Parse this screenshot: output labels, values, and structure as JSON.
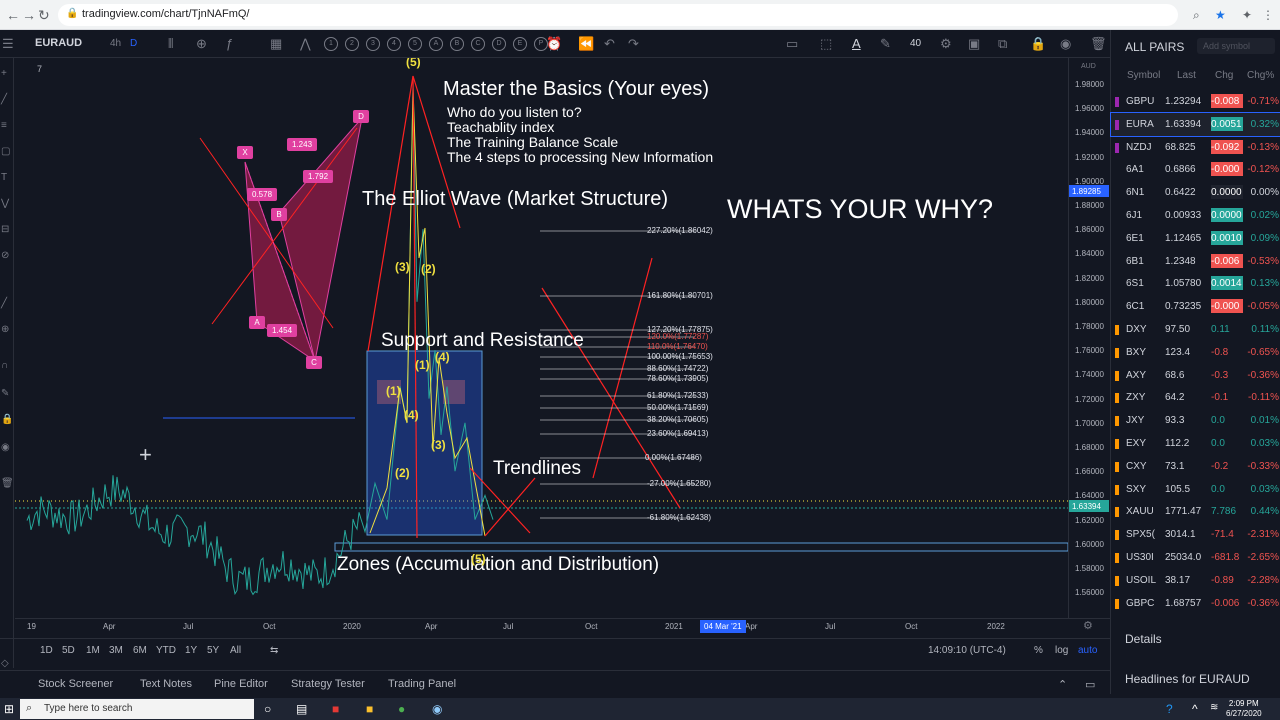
{
  "browser": {
    "url": "tradingview.com/chart/TjnNAFmQ/"
  },
  "toolbar": {
    "symbol": "EURAUD",
    "interval": "4h",
    "interval_sel": "D",
    "zoom": "40",
    "wave_marks": [
      "1",
      "2",
      "3",
      "4",
      "5",
      "A",
      "B",
      "C",
      "D",
      "E",
      "P"
    ]
  },
  "chart": {
    "counter": "7",
    "price_ticks": [
      "1.98000",
      "1.96000",
      "1.94000",
      "1.92000",
      "1.90000",
      "1.88000",
      "1.86000",
      "1.84000",
      "1.82000",
      "1.80000",
      "1.78000",
      "1.76000",
      "1.74000",
      "1.72000",
      "1.70000",
      "1.68000",
      "1.66000",
      "1.64000",
      "1.62000",
      "1.60000",
      "1.58000",
      "1.56000"
    ],
    "current_price": "1.89285",
    "last_price_tag": "1.63394",
    "axis_top": "AUD",
    "time_ticks": [
      "19",
      "Apr",
      "Jul",
      "Oct",
      "2020",
      "Apr",
      "Jul",
      "Oct",
      "2021",
      "Apr",
      "Jul",
      "Oct",
      "2022"
    ],
    "cursor_date": "04 Mar '21",
    "annotations": {
      "title": "Master the Basics (Your eyes)",
      "line1": "Who do you listen to?",
      "line2": "Teachablity index",
      "line3": "The Training Balance Scale",
      "line4": "The 4 steps to processing New Information",
      "elliot": "The Elliot Wave (Market Structure)",
      "why": "WHATS YOUR WHY?",
      "sr": "Support and Resistance",
      "trend": "Trendlines",
      "zones": "Zones (Accumulation and Distribution)"
    },
    "fib_levels": [
      "227.20%(1.86042)",
      "161.80%(1.80701)",
      "127.20%(1.77875)",
      "120.0%(1.77287)",
      "110.0%(1.76470)",
      "100.00%(1.75653)",
      "88.60%(1.74722)",
      "78.60%(1.73905)",
      "61.80%(1.72533)",
      "50.00%(1.71569)",
      "38.20%(1.70605)",
      "23.60%(1.69413)",
      "0.00%(1.67486)",
      "-27.00%(1.65280)",
      "-61.80%(1.62438)"
    ],
    "harmonic": {
      "points": [
        "X",
        "A",
        "B",
        "C",
        "D"
      ],
      "ratios": [
        "1.243",
        "0.578",
        "1.792",
        "1.454"
      ]
    },
    "waves": [
      "(5)",
      "(3)",
      "(2)",
      "(1)",
      "(4)",
      "(1)",
      "(4)",
      "(3)",
      "(2)",
      "(5)"
    ]
  },
  "range_bar": {
    "ranges": [
      "1D",
      "5D",
      "1M",
      "3M",
      "6M",
      "YTD",
      "1Y",
      "5Y",
      "All"
    ],
    "time": "14:09:10 (UTC-4)",
    "pct": "%",
    "log": "log",
    "auto": "auto"
  },
  "panel_tabs": [
    "Stock Screener",
    "Text Notes",
    "Pine Editor",
    "Strategy Tester",
    "Trading Panel"
  ],
  "watchlist": {
    "title": "ALL PAIRS",
    "add_placeholder": "Add symbol",
    "headers": [
      "Symbol",
      "Last",
      "Chg",
      "Chg%"
    ],
    "rows": [
      {
        "sym": "GBPU",
        "last": "1.23294",
        "chg": "-0.008",
        "chgp": "-0.71%",
        "dir": "neg",
        "flag": "#9c27b0"
      },
      {
        "sym": "EURA",
        "last": "1.63394",
        "chg": "0.0051",
        "chgp": "0.32%",
        "dir": "pos",
        "flag": "#9c27b0"
      },
      {
        "sym": "NZDJ",
        "last": "68.825",
        "chg": "-0.092",
        "chgp": "-0.13%",
        "dir": "neg",
        "flag": "#9c27b0"
      },
      {
        "sym": "6A1",
        "last": "0.6866",
        "chg": "-0.000",
        "chgp": "-0.12%",
        "dir": "neg",
        "flag": "#131722"
      },
      {
        "sym": "6N1",
        "last": "0.6422",
        "chg": "0.0000",
        "chgp": "0.00%",
        "dir": "neu",
        "flag": "#131722"
      },
      {
        "sym": "6J1",
        "last": "0.00933",
        "chg": "0.0000",
        "chgp": "0.02%",
        "dir": "pos",
        "flag": "#131722"
      },
      {
        "sym": "6E1",
        "last": "1.12465",
        "chg": "0.0010",
        "chgp": "0.09%",
        "dir": "pos",
        "flag": "#131722"
      },
      {
        "sym": "6B1",
        "last": "1.2348",
        "chg": "-0.006",
        "chgp": "-0.53%",
        "dir": "neg",
        "flag": "#131722"
      },
      {
        "sym": "6S1",
        "last": "1.05780",
        "chg": "0.0014",
        "chgp": "0.13%",
        "dir": "pos",
        "flag": "#131722"
      },
      {
        "sym": "6C1",
        "last": "0.73235",
        "chg": "-0.000",
        "chgp": "-0.05%",
        "dir": "neg",
        "flag": "#131722"
      },
      {
        "sym": "DXY",
        "last": "97.50",
        "chg": "0.11",
        "chgp": "0.11%",
        "dir": "pos",
        "flag": "#ff9800"
      },
      {
        "sym": "BXY",
        "last": "123.4",
        "chg": "-0.8",
        "chgp": "-0.65%",
        "dir": "neg",
        "flag": "#ff9800"
      },
      {
        "sym": "AXY",
        "last": "68.6",
        "chg": "-0.3",
        "chgp": "-0.36%",
        "dir": "neg",
        "flag": "#ff9800"
      },
      {
        "sym": "ZXY",
        "last": "64.2",
        "chg": "-0.1",
        "chgp": "-0.11%",
        "dir": "neg",
        "flag": "#ff9800"
      },
      {
        "sym": "JXY",
        "last": "93.3",
        "chg": "0.0",
        "chgp": "0.01%",
        "dir": "pos",
        "flag": "#ff9800"
      },
      {
        "sym": "EXY",
        "last": "112.2",
        "chg": "0.0",
        "chgp": "0.03%",
        "dir": "pos",
        "flag": "#ff9800"
      },
      {
        "sym": "CXY",
        "last": "73.1",
        "chg": "-0.2",
        "chgp": "-0.33%",
        "dir": "neg",
        "flag": "#ff9800"
      },
      {
        "sym": "SXY",
        "last": "105.5",
        "chg": "0.0",
        "chgp": "0.03%",
        "dir": "pos",
        "flag": "#ff9800"
      },
      {
        "sym": "XAUU",
        "last": "1771.47",
        "chg": "7.786",
        "chgp": "0.44%",
        "dir": "pos",
        "flag": "#ff9800"
      },
      {
        "sym": "SPX5(",
        "last": "3014.1",
        "chg": "-71.4",
        "chgp": "-2.31%",
        "dir": "neg",
        "flag": "#ff9800"
      },
      {
        "sym": "US30I",
        "last": "25034.0",
        "chg": "-681.8",
        "chgp": "-2.65%",
        "dir": "neg",
        "flag": "#ff9800"
      },
      {
        "sym": "USOIL",
        "last": "38.17",
        "chg": "-0.89",
        "chgp": "-2.28%",
        "dir": "neg",
        "flag": "#ff9800"
      },
      {
        "sym": "GBPC",
        "last": "1.68757",
        "chg": "-0.006",
        "chgp": "-0.36%",
        "dir": "neg",
        "flag": "#ff9800"
      }
    ],
    "details": "Details",
    "headlines": "Headlines for EURAUD"
  },
  "taskbar": {
    "search": "Type here to search",
    "time": "2:09 PM",
    "date": "6/27/2020"
  }
}
